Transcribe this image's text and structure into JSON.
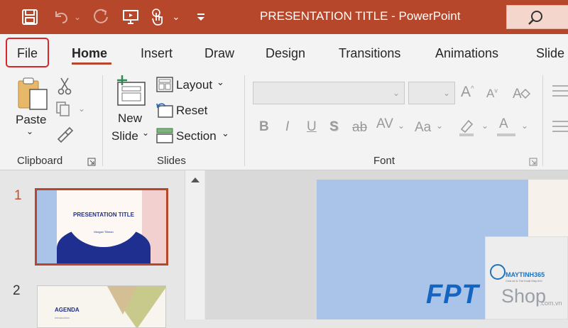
{
  "app": {
    "title": "PRESENTATION TITLE  -  PowerPoint",
    "brand_color": "#b7472a"
  },
  "quick_access": {
    "icons": [
      "save-icon",
      "undo-icon",
      "redo-icon",
      "start-from-beginning-icon",
      "touch-mode-icon",
      "customize-qat-icon"
    ]
  },
  "search": {
    "icon": "search-icon"
  },
  "tabs": [
    {
      "label": "File"
    },
    {
      "label": "Home",
      "active": true
    },
    {
      "label": "Insert"
    },
    {
      "label": "Draw"
    },
    {
      "label": "Design"
    },
    {
      "label": "Transitions"
    },
    {
      "label": "Animations"
    },
    {
      "label": "Slide"
    }
  ],
  "ribbon": {
    "clipboard": {
      "group_label": "Clipboard",
      "paste_label": "Paste"
    },
    "slides": {
      "group_label": "Slides",
      "new_slide_line1": "New",
      "new_slide_line2": "Slide",
      "layout_label": "Layout",
      "reset_label": "Reset",
      "section_label": "Section"
    },
    "font": {
      "group_label": "Font",
      "font_name_value": "",
      "font_size_value": "",
      "bold": "B",
      "italic": "I",
      "underline": "U",
      "shadow": "S",
      "strikethrough": "ab",
      "char_spacing": "AV",
      "change_case": "Aa",
      "increase_size": "A",
      "decrease_size": "A",
      "font_color": "A"
    }
  },
  "slides_panel": {
    "slides": [
      {
        "number": "1",
        "selected": true,
        "title": "PRESENTATION TITLE",
        "subtitle": "Morgan Tillman"
      },
      {
        "number": "2",
        "selected": false,
        "title": "AGENDA",
        "subtitle": "Introduction"
      }
    ]
  },
  "watermark": {
    "fpt_text": "FPT",
    "shop_text": "Shop",
    "shop_suffix": ".com.vn",
    "maytinh_text": "MAYTINH365",
    "maytinh_tagline": "Chia sẻ & Thủ thuật Máy tính"
  }
}
